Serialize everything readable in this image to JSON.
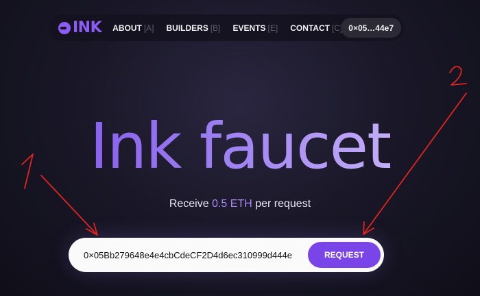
{
  "nav": {
    "logo_text": "INK",
    "items": [
      {
        "label": "ABOUT",
        "key": "[A]"
      },
      {
        "label": "BUILDERS",
        "key": "[B]"
      },
      {
        "label": "EVENTS",
        "key": "[E]"
      },
      {
        "label": "CONTACT",
        "key": "[C]"
      }
    ],
    "wallet": "0×05…44e7"
  },
  "hero": {
    "title": "Ink faucet",
    "subtitle_prefix": "Receive ",
    "subtitle_amount": "0.5 ETH",
    "subtitle_suffix": " per request"
  },
  "form": {
    "address_value": "0×05Bb279648e4e4cbCdeCF2D4d6ec310999d444e",
    "button_label": "REQUEST"
  },
  "annotations": {
    "label_1": "1",
    "label_2": "2",
    "color": "#e0241f"
  }
}
